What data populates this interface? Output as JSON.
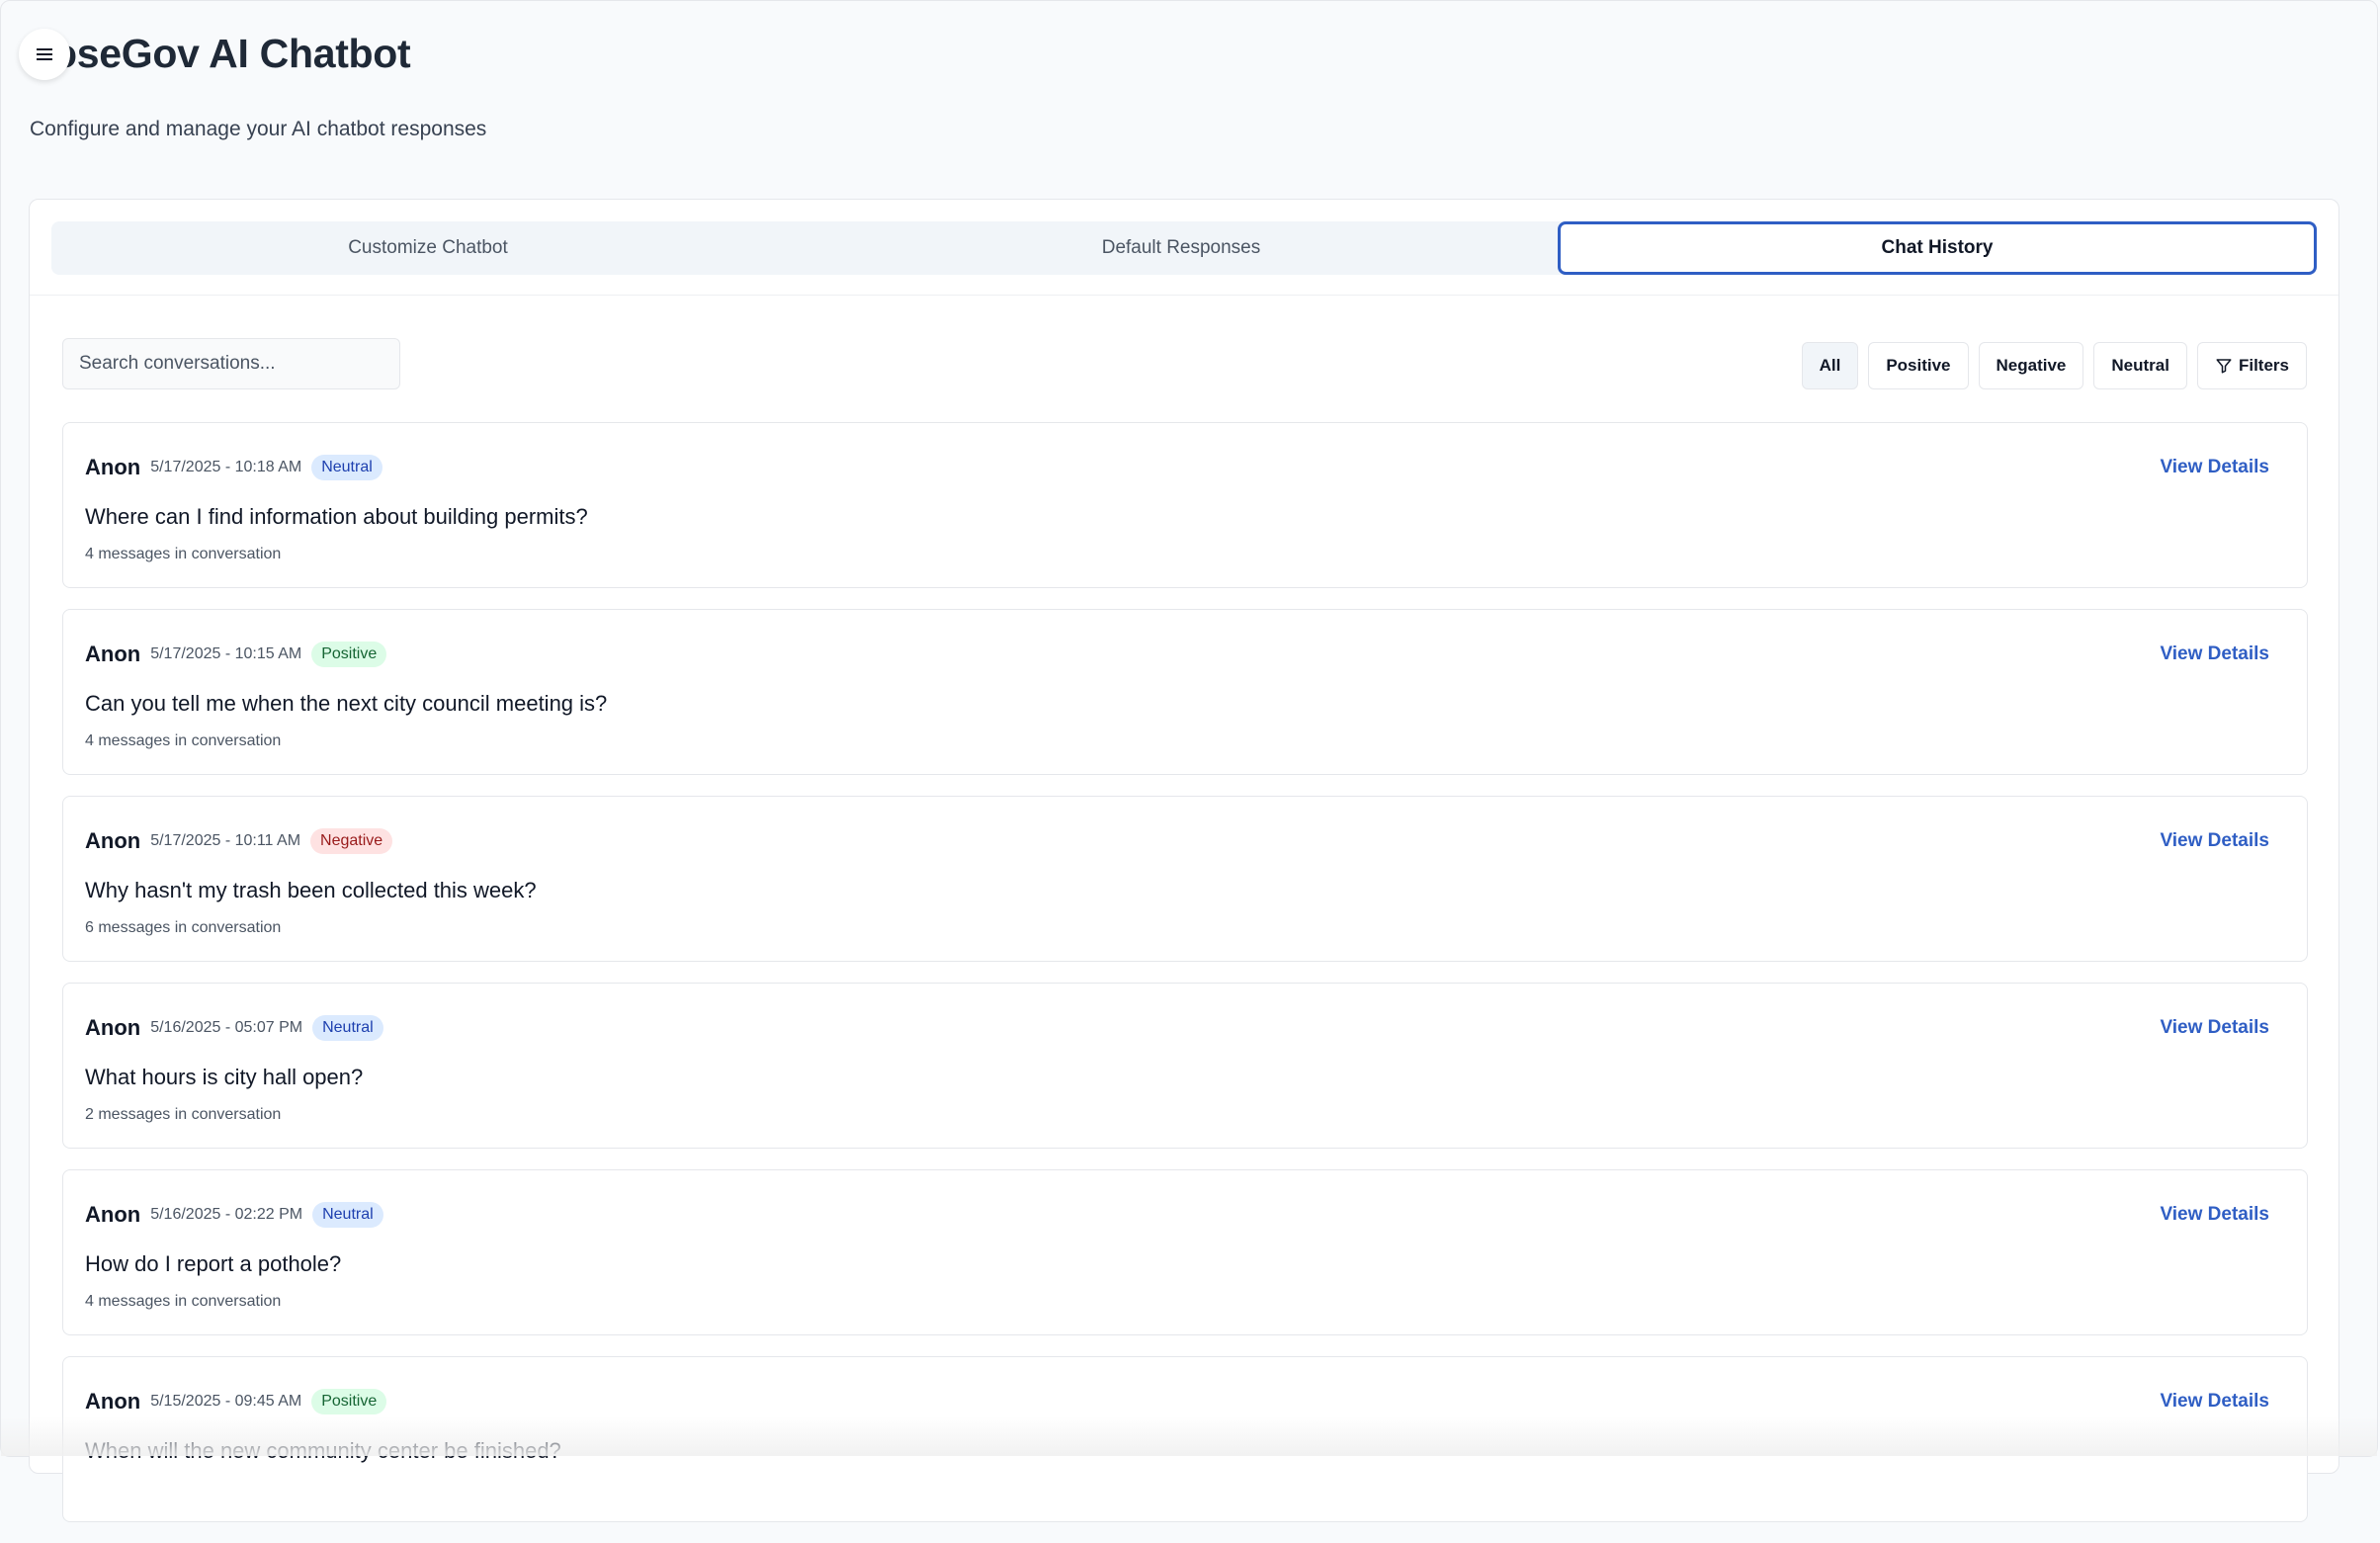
{
  "header": {
    "title": "oseGov AI Chatbot",
    "subtitle": "Configure and manage your AI chatbot responses"
  },
  "tabs": [
    {
      "label": "Customize Chatbot",
      "active": false
    },
    {
      "label": "Default Responses",
      "active": false
    },
    {
      "label": "Chat History",
      "active": true
    }
  ],
  "search": {
    "placeholder": "Search conversations...",
    "value": ""
  },
  "filters": {
    "all": "All",
    "positive": "Positive",
    "negative": "Negative",
    "neutral": "Neutral",
    "filters": "Filters",
    "selected": "All"
  },
  "sentiment_colors": {
    "Neutral": {
      "bg": "#dbeafe",
      "fg": "#1e40af"
    },
    "Positive": {
      "bg": "#dcfce7",
      "fg": "#166534"
    },
    "Negative": {
      "bg": "#fee2e2",
      "fg": "#991b1b"
    }
  },
  "accent_color": "#2f5ec4",
  "conversations": [
    {
      "author": "Anon",
      "timestamp": "5/17/2025 - 10:18 AM",
      "sentiment": "Neutral",
      "question": "Where can I find information about building permits?",
      "messages": "4 messages in conversation",
      "action": "View Details"
    },
    {
      "author": "Anon",
      "timestamp": "5/17/2025 - 10:15 AM",
      "sentiment": "Positive",
      "question": "Can you tell me when the next city council meeting is?",
      "messages": "4 messages in conversation",
      "action": "View Details"
    },
    {
      "author": "Anon",
      "timestamp": "5/17/2025 - 10:11 AM",
      "sentiment": "Negative",
      "question": "Why hasn't my trash been collected this week?",
      "messages": "6 messages in conversation",
      "action": "View Details"
    },
    {
      "author": "Anon",
      "timestamp": "5/16/2025 - 05:07 PM",
      "sentiment": "Neutral",
      "question": "What hours is city hall open?",
      "messages": "2 messages in conversation",
      "action": "View Details"
    },
    {
      "author": "Anon",
      "timestamp": "5/16/2025 - 02:22 PM",
      "sentiment": "Neutral",
      "question": "How do I report a pothole?",
      "messages": "4 messages in conversation",
      "action": "View Details"
    },
    {
      "author": "Anon",
      "timestamp": "5/15/2025 - 09:45 AM",
      "sentiment": "Positive",
      "question": "When will the new community center be finished?",
      "messages": "",
      "action": "View Details"
    }
  ]
}
